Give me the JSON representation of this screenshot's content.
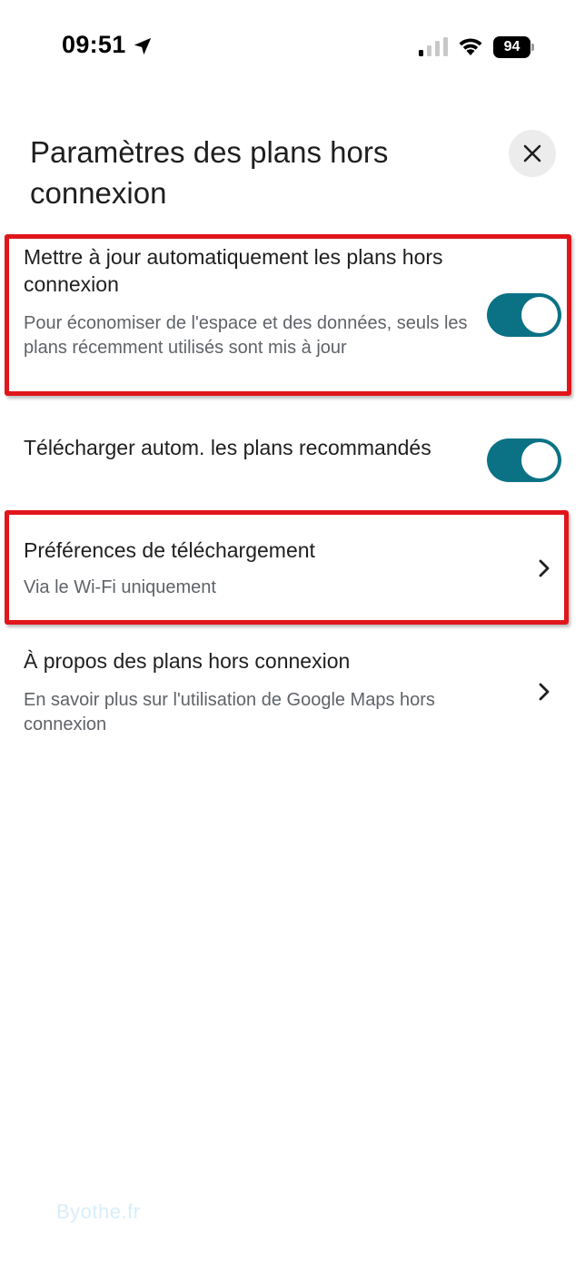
{
  "status_bar": {
    "time": "09:51",
    "battery": "94"
  },
  "header": {
    "title": "Paramètres des plans hors connexion"
  },
  "settings": [
    {
      "title": "Mettre à jour automatiquement les plans hors connexion",
      "subtitle": "Pour économiser de l'espace et des données, seuls les plans récemment utilisés sont mis à jour",
      "control": "toggle",
      "toggle_on": true
    },
    {
      "title": "Télécharger autom. les plans recommandés",
      "control": "toggle",
      "toggle_on": true
    },
    {
      "title": "Préférences de téléchargement",
      "subtitle": "Via le Wi-Fi uniquement",
      "control": "chevron-right-icon"
    },
    {
      "title": "À propos des plans hors connexion",
      "subtitle": "En savoir plus sur l'utilisation de Google Maps hors connexion",
      "control": "chevron-right-icon"
    }
  ],
  "watermark": "Byothe.fr",
  "colors": {
    "toggle_accent": "#0b7285",
    "highlight": "#e0161b",
    "secondary_text": "#5f6368"
  }
}
